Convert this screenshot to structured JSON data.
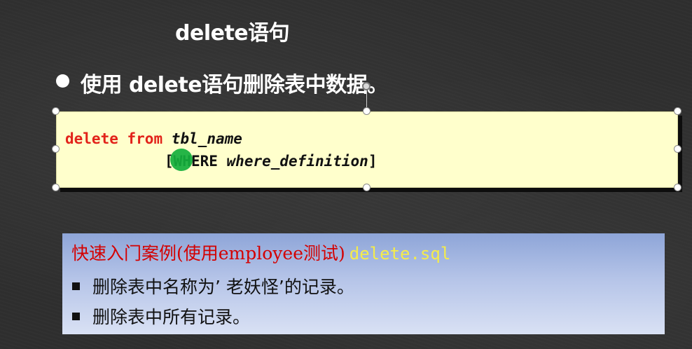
{
  "slide": {
    "title": "delete语句",
    "bullet": "使用 delete语句删除表中数据。"
  },
  "code": {
    "keyword_delete": "delete",
    "keyword_from": "from",
    "table_name": "tbl_name",
    "bracket_open": "[",
    "keyword_where": "WHERE",
    "where_definition": "where_definition",
    "bracket_close": "]"
  },
  "example": {
    "heading": "快速入门案例(使用employee测试)",
    "file": "delete.sql",
    "items": [
      "删除表中名称为’ 老妖怪’的记录。",
      "删除表中所有记录。"
    ]
  },
  "colors": {
    "background": "#2f2f2f",
    "code_background": "#ffffcc",
    "keyword": "#e2231a",
    "heading_red": "#d40000",
    "file_yellow": "#f5ec4a",
    "cursor_green": "#14af3c"
  }
}
